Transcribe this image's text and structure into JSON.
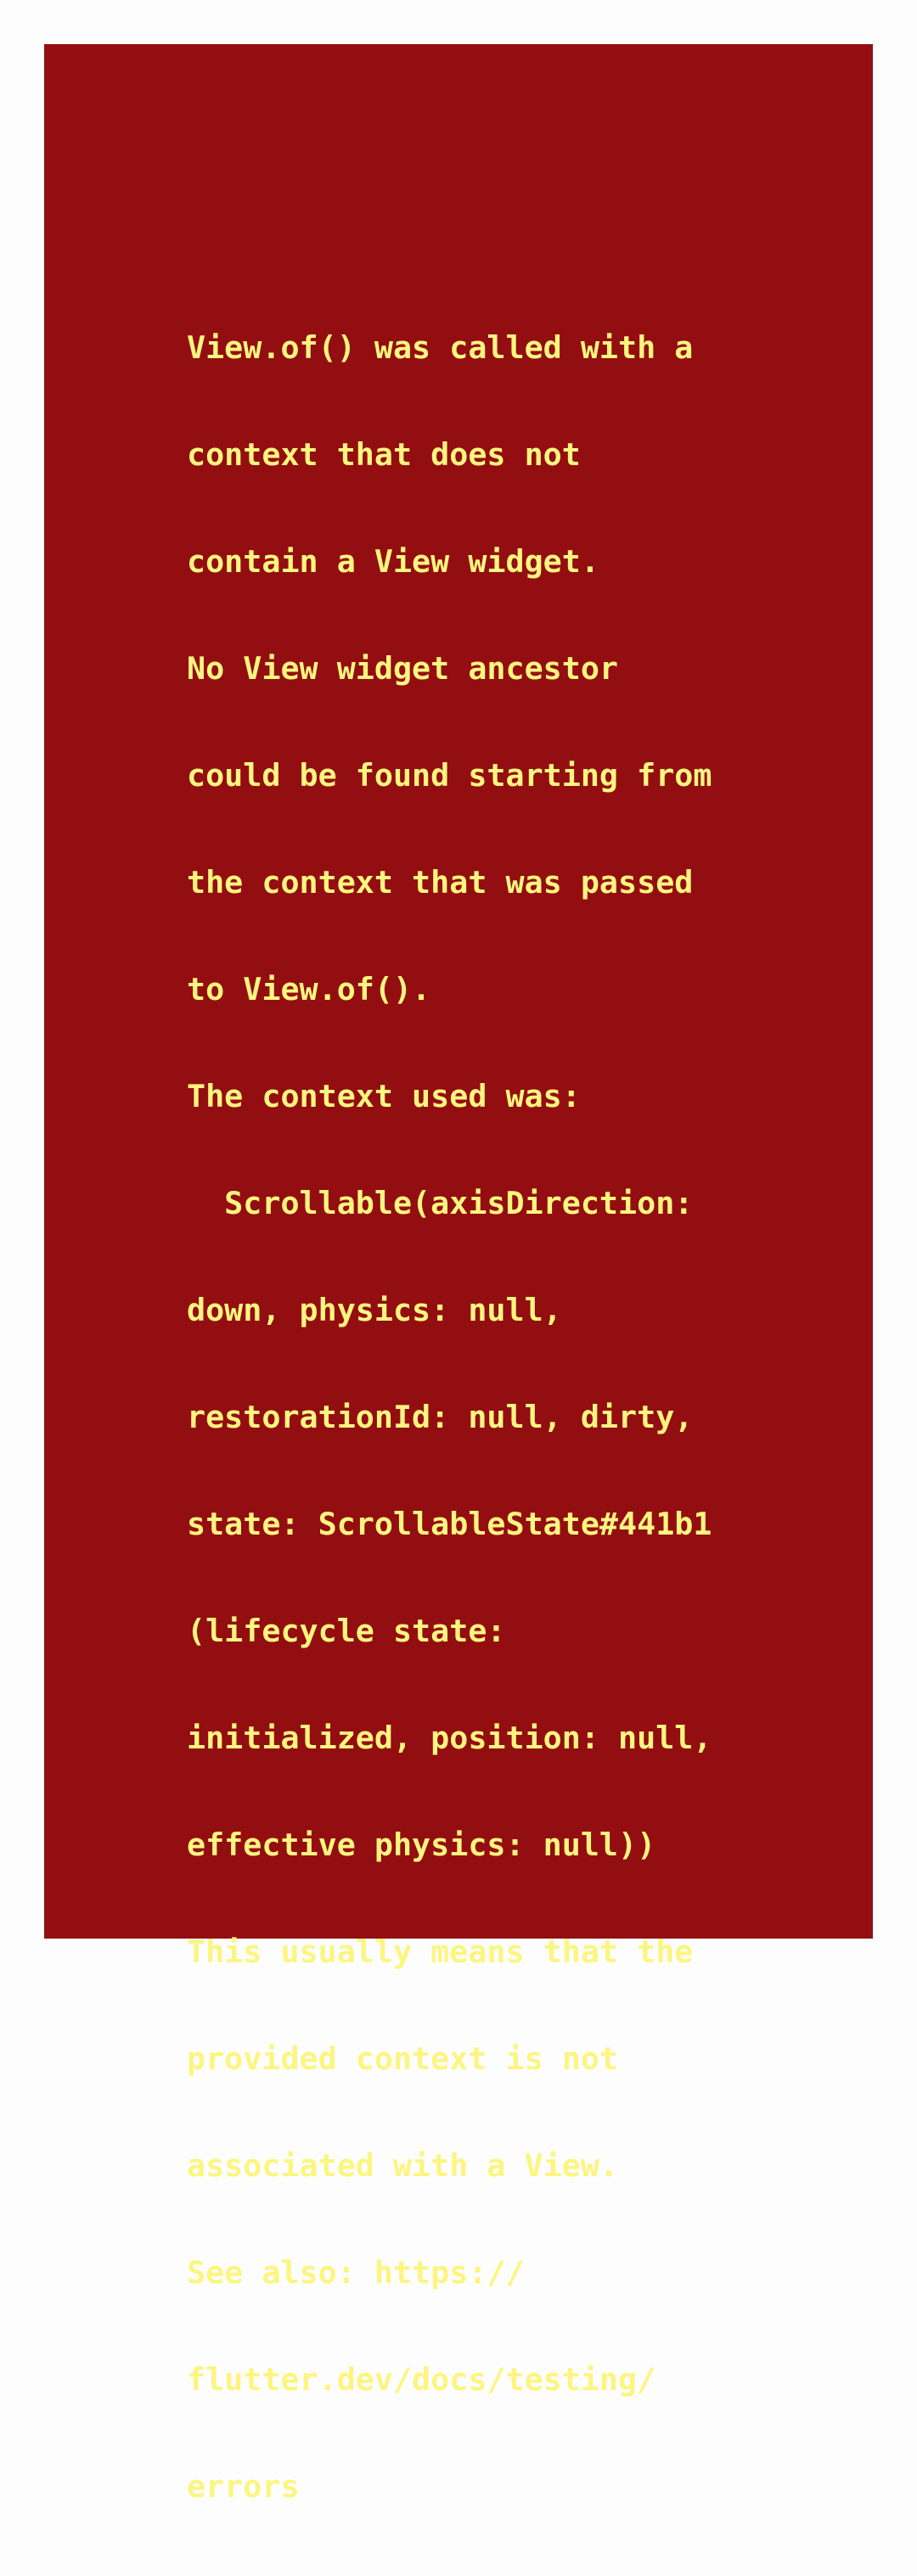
{
  "error": {
    "lines": [
      "View.of() was called with a",
      "context that does not",
      "contain a View widget.",
      "No View widget ancestor",
      "could be found starting from",
      "the context that was passed",
      "to View.of().",
      "The context used was:",
      "  Scrollable(axisDirection:",
      "down, physics: null,",
      "restorationId: null, dirty,",
      "state: ScrollableState#441b1",
      "(lifecycle state:",
      "initialized, position: null,",
      "effective physics: null))",
      "This usually means that the",
      "provided context is not",
      "associated with a View.",
      "See also: https://",
      "flutter.dev/docs/testing/",
      "errors"
    ],
    "colors": {
      "page_background": "#fdfdfd",
      "panel_background": "#930e10",
      "text": "#fcf580"
    }
  }
}
